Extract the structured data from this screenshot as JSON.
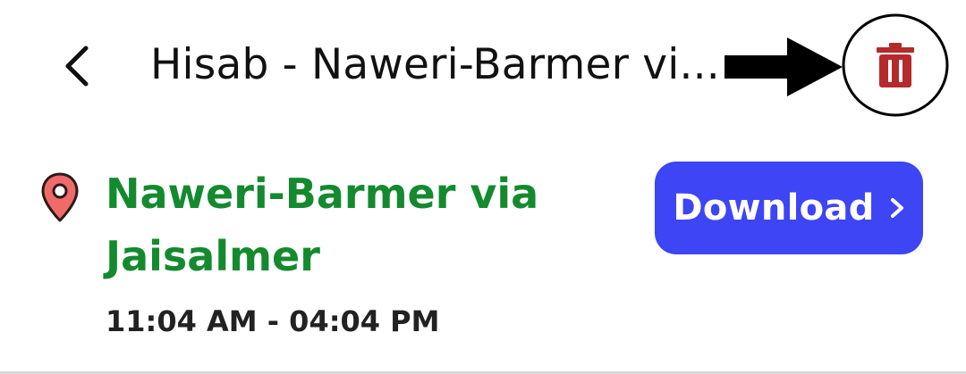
{
  "header": {
    "title": "Hisab - Naweri-Barmer vi...",
    "back_icon": "chevron-left-icon",
    "delete_icon": "trash-icon",
    "delete_color": "#b52a2a"
  },
  "route": {
    "location_icon": "map-pin-icon",
    "name": "Naweri-Barmer via Jaisalmer",
    "name_color": "#148a2e",
    "time_range": "11:04 AM - 04:04 PM"
  },
  "download": {
    "label": "Download",
    "chevron_icon": "chevron-right-icon",
    "background": "#3d45f5"
  }
}
